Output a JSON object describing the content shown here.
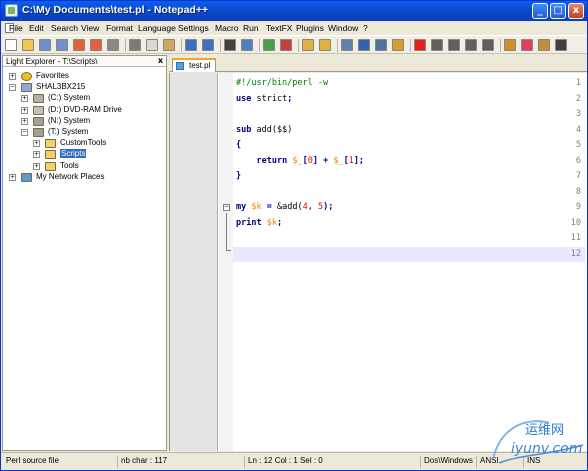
{
  "window": {
    "title": "C:\\My Documents\\test.pl - Notepad++",
    "minimize": "_",
    "maximize": "□",
    "close": "x"
  },
  "menu": [
    "File",
    "Edit",
    "Search",
    "View",
    "Format",
    "Language",
    "Settings",
    "Macro",
    "Run",
    "TextFX",
    "Plugins",
    "Window",
    "?"
  ],
  "toolbar": {
    "buttons": [
      {
        "name": "new-file",
        "color": "#ffffff"
      },
      {
        "name": "open-file",
        "color": "#f4c64e"
      },
      {
        "name": "save",
        "color": "#6f8fd0"
      },
      {
        "name": "save-all",
        "color": "#6f8fd0"
      },
      {
        "name": "close-file",
        "color": "#e06040"
      },
      {
        "name": "close-all",
        "color": "#e06040"
      },
      {
        "name": "print",
        "color": "#8a8a8a"
      },
      {
        "name": "cut",
        "color": "#7a7a7a"
      },
      {
        "name": "copy",
        "color": "#d8d8d8"
      },
      {
        "name": "paste",
        "color": "#d0a860"
      },
      {
        "name": "undo",
        "color": "#3b6fc4"
      },
      {
        "name": "redo",
        "color": "#3b6fc4"
      },
      {
        "name": "find",
        "color": "#404040"
      },
      {
        "name": "replace",
        "color": "#5080c0"
      },
      {
        "name": "zoom-in",
        "color": "#4aa04a"
      },
      {
        "name": "zoom-out",
        "color": "#c04040"
      },
      {
        "name": "sync-vertical",
        "color": "#e0b040"
      },
      {
        "name": "sync-horizontal",
        "color": "#e0b040"
      },
      {
        "name": "word-wrap",
        "color": "#6080b0"
      },
      {
        "name": "show-all-chars",
        "color": "#3060b0"
      },
      {
        "name": "indent-guide",
        "color": "#5070a0"
      },
      {
        "name": "user-lang",
        "color": "#d0a030"
      },
      {
        "name": "record-macro",
        "color": "#e02020"
      },
      {
        "name": "stop-record",
        "color": "#606060"
      },
      {
        "name": "play-macro",
        "color": "#606060"
      },
      {
        "name": "play-multiple",
        "color": "#606060"
      },
      {
        "name": "save-macro",
        "color": "#606060"
      },
      {
        "name": "plugin-a",
        "color": "#d09030"
      },
      {
        "name": "plugin-b",
        "color": "#e04060"
      },
      {
        "name": "plugin-c",
        "color": "#c09040"
      },
      {
        "name": "help",
        "color": "#404040"
      }
    ]
  },
  "explorer": {
    "title": "Light Explorer - T:\\Scripts\\",
    "close": "x",
    "tree": [
      {
        "label": "Favorites",
        "icon": "star-icon",
        "level": 0,
        "expander": "+",
        "icon_color": "#f0c020",
        "selected": false
      },
      {
        "label": "SHAL3BX215",
        "icon": "computer-icon",
        "level": 0,
        "expander": "−",
        "icon_color": "#8aa8d8",
        "selected": false
      },
      {
        "label": "(C:) System",
        "icon": "drive-icon",
        "level": 1,
        "expander": "+",
        "icon_color": "#b0b0b0",
        "selected": false
      },
      {
        "label": "(D:) DVD-RAM Drive",
        "icon": "disc-drive-icon",
        "level": 1,
        "expander": "+",
        "icon_color": "#c0c0c0",
        "selected": false
      },
      {
        "label": "(N:) System",
        "icon": "network-drive-icon",
        "level": 1,
        "expander": "+",
        "icon_color": "#a0a0a0",
        "selected": false
      },
      {
        "label": "(T:) System",
        "icon": "network-drive-icon",
        "level": 1,
        "expander": "−",
        "icon_color": "#a0a0a0",
        "selected": false
      },
      {
        "label": "CustomTools",
        "icon": "folder-icon",
        "level": 2,
        "expander": "+",
        "icon_color": "#f2d16b",
        "selected": false
      },
      {
        "label": "Scripts",
        "icon": "folder-icon",
        "level": 2,
        "expander": "+",
        "icon_color": "#f2d16b",
        "selected": true
      },
      {
        "label": "Tools",
        "icon": "folder-icon",
        "level": 2,
        "expander": "+",
        "icon_color": "#f2d16b",
        "selected": false
      },
      {
        "label": "My Network Places",
        "icon": "network-places-icon",
        "level": 0,
        "expander": "+",
        "icon_color": "#5a9ad8",
        "selected": false
      }
    ]
  },
  "editor": {
    "tab": "test.pl",
    "current_line": 12,
    "lines": [
      [
        {
          "t": "#!/usr/bin/perl -w",
          "c": "c-comment"
        }
      ],
      [
        {
          "t": "use",
          "c": "c-kw"
        },
        {
          "t": " strict",
          "c": "c-plain"
        },
        {
          "t": ";",
          "c": "c-punct"
        }
      ],
      [],
      [
        {
          "t": "sub",
          "c": "c-kw"
        },
        {
          "t": " add(",
          "c": "c-plain"
        },
        {
          "t": "$$",
          "c": "c-plain"
        },
        {
          "t": ")",
          "c": "c-plain"
        }
      ],
      [
        {
          "t": "{",
          "c": "c-punct"
        }
      ],
      [
        {
          "t": "    ",
          "c": "c-plain"
        },
        {
          "t": "return",
          "c": "c-kw"
        },
        {
          "t": " ",
          "c": "c-plain"
        },
        {
          "t": "$_",
          "c": "c-var"
        },
        {
          "t": "[",
          "c": "c-punct"
        },
        {
          "t": "0",
          "c": "c-num"
        },
        {
          "t": "]",
          "c": "c-punct"
        },
        {
          "t": " + ",
          "c": "c-punct"
        },
        {
          "t": "$_",
          "c": "c-var"
        },
        {
          "t": "[",
          "c": "c-punct"
        },
        {
          "t": "1",
          "c": "c-num"
        },
        {
          "t": "];",
          "c": "c-punct"
        }
      ],
      [
        {
          "t": "}",
          "c": "c-punct"
        }
      ],
      [],
      [
        {
          "t": "my",
          "c": "c-kw"
        },
        {
          "t": " ",
          "c": "c-plain"
        },
        {
          "t": "$k",
          "c": "c-var"
        },
        {
          "t": " = ",
          "c": "c-punct"
        },
        {
          "t": "&add(",
          "c": "c-plain"
        },
        {
          "t": "4",
          "c": "c-num"
        },
        {
          "t": ", ",
          "c": "c-plain"
        },
        {
          "t": "5",
          "c": "c-num"
        },
        {
          "t": ");",
          "c": "c-punct"
        }
      ],
      [
        {
          "t": "print",
          "c": "c-kw"
        },
        {
          "t": " ",
          "c": "c-plain"
        },
        {
          "t": "$k",
          "c": "c-var"
        },
        {
          "t": ";",
          "c": "c-punct"
        }
      ],
      [],
      []
    ]
  },
  "status": {
    "file_type": "Perl source file",
    "nb_char": "nb char : 117",
    "position": "Ln : 12   Col : 1   Sel : 0",
    "eol": "Dos\\Windows",
    "encoding": "ANSI",
    "mode": "INS"
  },
  "watermark": {
    "line1": "运维网",
    "line2": "iyunv.com"
  }
}
